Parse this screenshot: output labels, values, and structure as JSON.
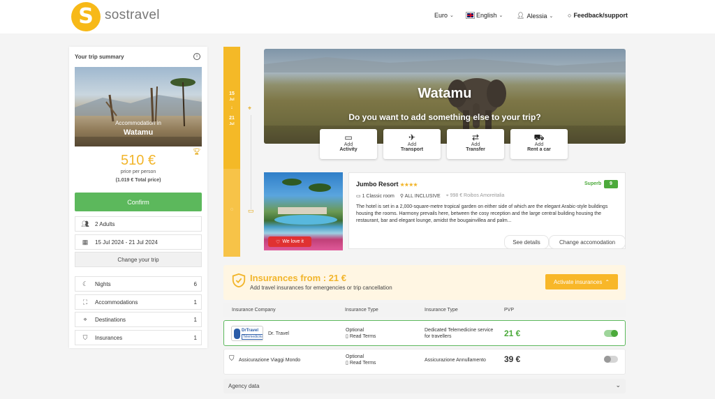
{
  "header": {
    "brand": "sostravel",
    "currency": "Euro",
    "language": "English",
    "user": "Alessia",
    "feedback": "Feedback/support"
  },
  "sidebar": {
    "title": "Your trip summary",
    "image_caption_line1": "Accommodation in",
    "image_caption_line2": "Watamu",
    "price": "510 €",
    "price_per": "price per person",
    "price_total": "(1.019 € Total price)",
    "confirm_label": "Confirm",
    "adults": "2 Adults",
    "dates": "15 Jul 2024 - 21 Jul 2024",
    "change_trip": "Change your trip",
    "counts": [
      {
        "label": "Nights",
        "value": "6"
      },
      {
        "label": "Accommodations",
        "value": "1"
      },
      {
        "label": "Destinations",
        "value": "1"
      },
      {
        "label": "Insurances",
        "value": "1"
      }
    ]
  },
  "timeline": {
    "start_day": "15",
    "start_month": "Jul",
    "end_day": "21",
    "end_month": "Jul"
  },
  "hero": {
    "title": "Watamu",
    "question": "Do you want to add something else to your trip?",
    "add_prefix": "Add",
    "actions": [
      "Activity",
      "Transport",
      "Transfer",
      "Rent a car"
    ]
  },
  "hotel": {
    "name": "Jumbo Resort",
    "stars": "★★★★",
    "rating_label": "Superb",
    "rating_score": "9",
    "room": "1 Classic room",
    "board": "ALL INCLUSIVE",
    "distance": "998 € Roibos Amoreitalia",
    "description": "The hotel is set in a 2,000-square-metre tropical garden on either side of which are the elegant Arabic-style buildings housing the rooms. Harmony prevails here, between the cosy reception and the large central building housing the restaurant, bar and elegant lounge, amidst the bougainvillea and palm...",
    "badge": "We love it",
    "see_details": "See details",
    "change": "Change accomodation"
  },
  "insurance": {
    "title": "Insurances from : 21 €",
    "subtitle": "Add travel insurances for emergencies or trip cancellation",
    "activate": "Activate insurances",
    "headers": [
      "Insurance Company",
      "Insurance Type",
      "Insurance Type",
      "PVP"
    ],
    "rows": [
      {
        "company": "Dr. Travel",
        "logo_line1": "DrTravel",
        "logo_line2": "Telemedicina",
        "type1": "Optional",
        "terms": "Read Terms",
        "type2": "Dedicated Telemedicine service for travellers",
        "price": "21 €",
        "active": true
      },
      {
        "company": "Assicurazione Viaggi Mondo",
        "type1": "Optional",
        "terms": "Read Terms",
        "type2": "Assicurazione Annullamento",
        "price": "39 €",
        "active": false
      }
    ]
  },
  "agency": {
    "label": "Agency data"
  },
  "colors": {
    "accent": "#f2b52b",
    "confirm": "#5cb85c",
    "love": "#e03131"
  }
}
